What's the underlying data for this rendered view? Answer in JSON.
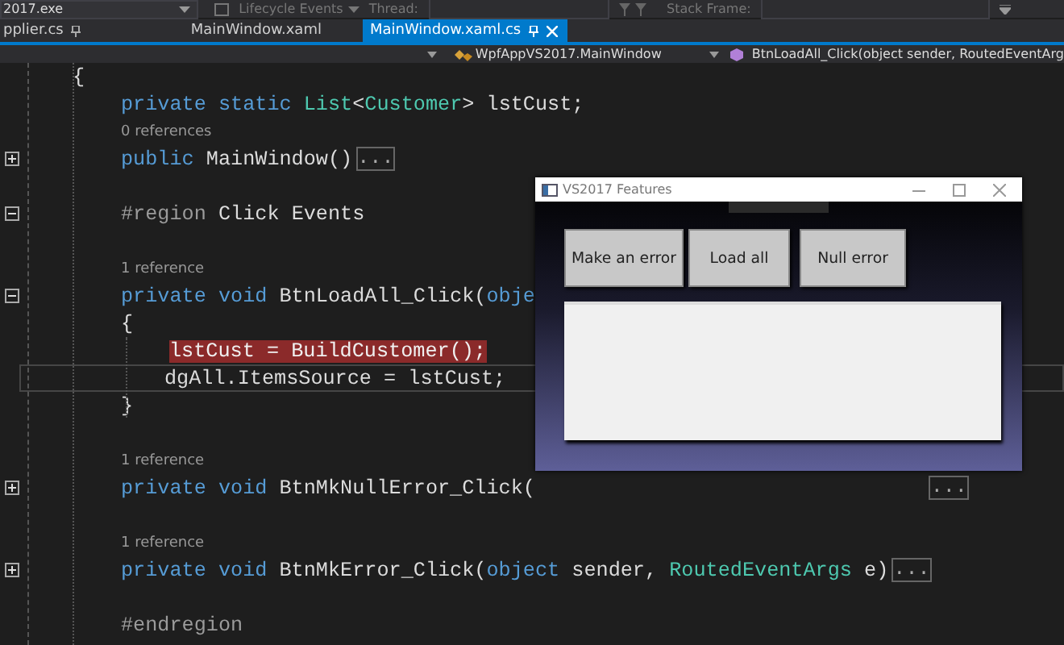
{
  "toolbar": {
    "process": "2017.exe",
    "lifecycle": "Lifecycle Events",
    "thread_label": "Thread:",
    "stack_label": "Stack Frame:"
  },
  "tabs": [
    {
      "label": "pplier.cs",
      "selected": false,
      "pinned": true
    },
    {
      "label": "MainWindow.xaml",
      "selected": false,
      "pinned": false
    },
    {
      "label": "MainWindow.xaml.cs",
      "selected": true,
      "pinned": true
    }
  ],
  "navbar": {
    "type": "WpfAppVS2017.MainWindow",
    "member": "BtnLoadAll_Click(object sender, RoutedEventArg"
  },
  "lines": [
    {
      "current": false,
      "tokens": [
        {
          "kind": "plain",
          "text": "{"
        }
      ],
      "children": [
        {
          "current": false,
          "tokens": [
            {
              "kind": "keyword",
              "text": "private static "
            },
            {
              "kind": "type",
              "text": "List"
            },
            {
              "kind": "plain",
              "text": "<"
            },
            {
              "kind": "type",
              "text": "Customer"
            },
            {
              "kind": "plain",
              "text": "> lstCust;"
            }
          ]
        },
        {
          "current": false,
          "tokens": [
            {
              "kind": "lens",
              "text": "0 references"
            }
          ]
        },
        {
          "expanded": false,
          "current": false,
          "tokens": [
            {
              "kind": "keyword",
              "text": "public "
            },
            {
              "kind": "plain",
              "text": "MainWindow()"
            },
            {
              "kind": "collapsed",
              "text": "..."
            }
          ]
        },
        {
          "current": false
        },
        {
          "expanded": true,
          "current": false,
          "tokens": [
            {
              "kind": "preproc",
              "text": "#region "
            },
            {
              "kind": "plain",
              "text": "Click Events"
            }
          ]
        },
        {
          "current": false
        },
        {
          "current": false,
          "tokens": [
            {
              "kind": "lens",
              "text": "1 reference"
            }
          ]
        },
        {
          "expanded": true,
          "current": false,
          "tokens": [
            {
              "kind": "keyword",
              "text": "private void "
            },
            {
              "kind": "plain",
              "text": "BtnLoadAll_Click("
            },
            {
              "kind": "keyword",
              "text": "obje"
            }
          ]
        },
        {
          "current": false,
          "tokens": [
            {
              "kind": "plain",
              "text": "{"
            }
          ],
          "children": [
            {
              "current": false,
              "tokens": [
                {
                  "kind": "error",
                  "text": "lstCust = BuildCustomer();"
                }
              ]
            },
            {
              "current": true,
              "tokens": [
                {
                  "kind": "plain",
                  "text": "dgAll.ItemsSource = lstCust;"
                }
              ]
            }
          ]
        },
        {
          "current": false,
          "tokens": [
            {
              "kind": "plain",
              "text": "}"
            }
          ]
        },
        {
          "current": false
        },
        {
          "current": false,
          "tokens": [
            {
              "kind": "lens",
              "text": "1 reference"
            }
          ]
        },
        {
          "expanded": false,
          "current": false,
          "tokens": [
            {
              "kind": "keyword",
              "text": "private void "
            },
            {
              "kind": "plain",
              "text": "BtnMkNullError_Click("
            },
            {
              "kind": "collapsed_far",
              "text": "..."
            }
          ]
        },
        {
          "current": false
        },
        {
          "current": false,
          "tokens": [
            {
              "kind": "lens",
              "text": "1 reference"
            }
          ]
        },
        {
          "expanded": false,
          "current": false,
          "tokens": [
            {
              "kind": "keyword",
              "text": "private void "
            },
            {
              "kind": "plain",
              "text": "BtnMkError_Click("
            },
            {
              "kind": "keyword",
              "text": "object "
            },
            {
              "kind": "plain",
              "text": "sender, "
            },
            {
              "kind": "type",
              "text": "RoutedEventArgs"
            },
            {
              "kind": "plain",
              "text": " e)"
            },
            {
              "kind": "collapsed",
              "text": "..."
            }
          ]
        },
        {
          "current": false
        },
        {
          "current": false,
          "tokens": [
            {
              "kind": "preproc",
              "text": "#endregion"
            }
          ]
        }
      ]
    }
  ],
  "app_window": {
    "title": "VS2017 Features",
    "buttons": [
      "Make an error",
      "Load all",
      "Null error"
    ]
  }
}
